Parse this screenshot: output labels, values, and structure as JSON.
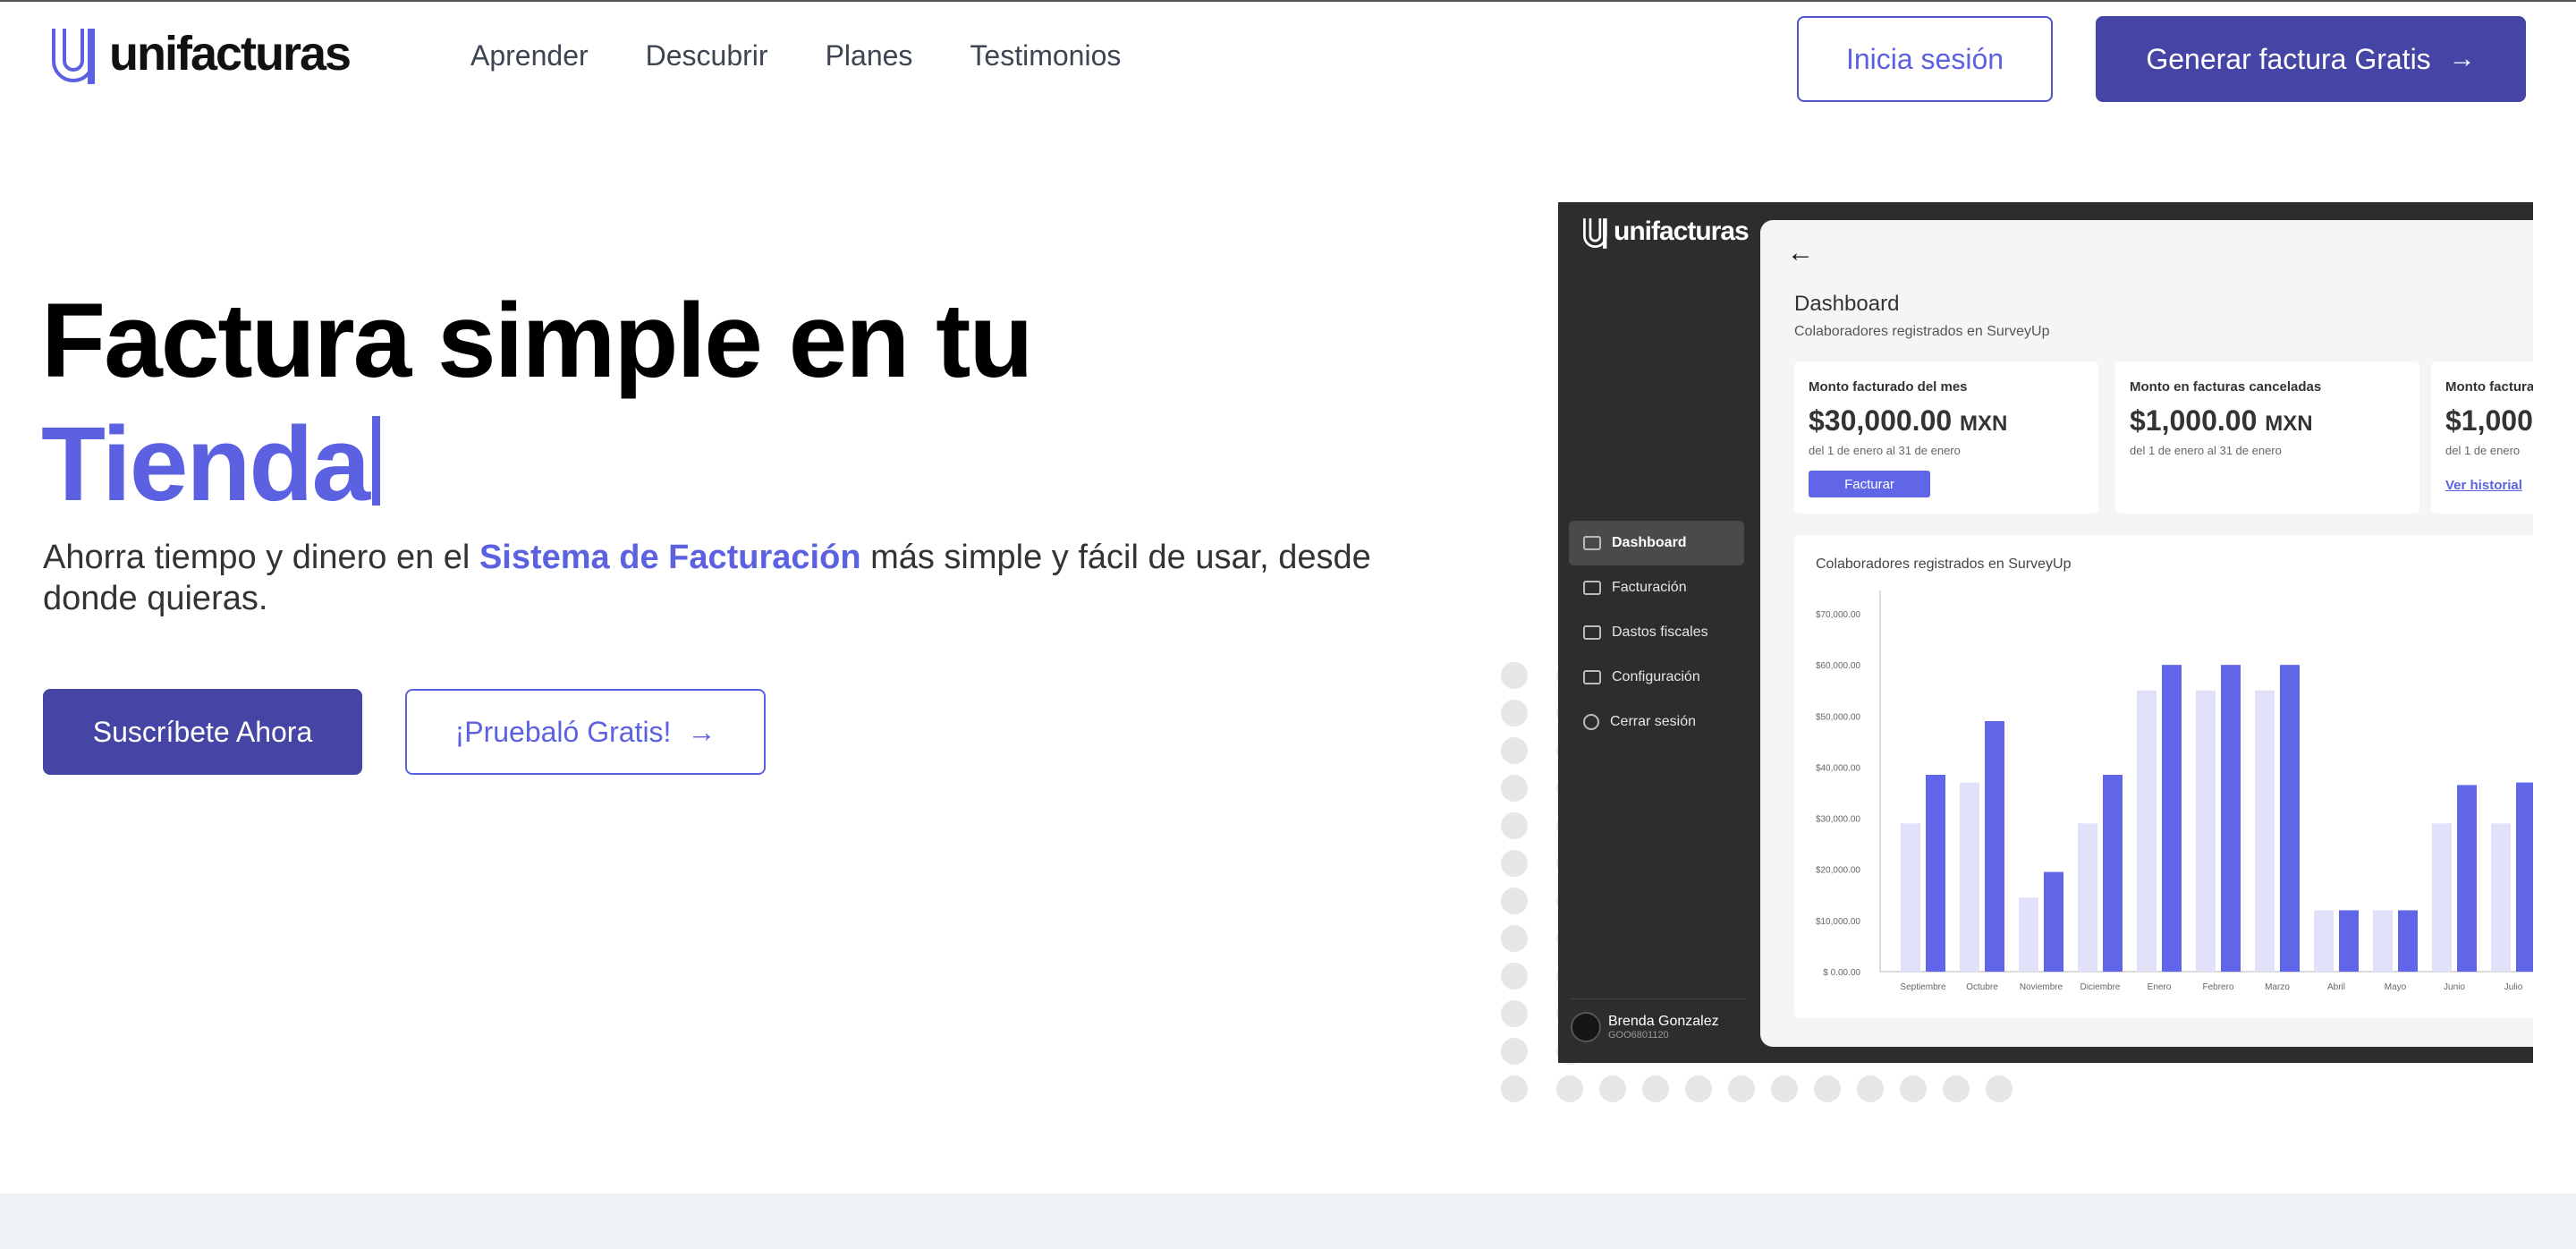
{
  "brand": {
    "name": "unifacturas",
    "accent": "#5b61e0",
    "primary": "#4545a6"
  },
  "nav": {
    "items": [
      {
        "label": "Aprender"
      },
      {
        "label": "Descubrir"
      },
      {
        "label": "Planes"
      },
      {
        "label": "Testimonios"
      }
    ],
    "login_label": "Inicia sesión",
    "cta_label": "Generar factura Gratis",
    "cta_icon": "arrow-right-icon"
  },
  "hero": {
    "title": "Factura simple en tu",
    "typed_word": "Tienda",
    "subtitle_before": "Ahorra tiempo y dinero en el ",
    "subtitle_highlight": "Sistema de Facturación",
    "subtitle_after": " más simple y fácil de usar, desde donde quieras.",
    "subscribe_label": "Suscríbete Ahora",
    "try_label": "¡Pruebaló Gratis!"
  },
  "dashboard": {
    "logo_text": "unifacturas",
    "menu": [
      {
        "label": "Dashboard",
        "icon": "monitor-icon",
        "active": true
      },
      {
        "label": "Facturación",
        "icon": "clipboard-icon",
        "active": false
      },
      {
        "label": "Dastos fiscales",
        "icon": "card-icon",
        "active": false
      },
      {
        "label": "Configuración",
        "icon": "card-icon",
        "active": false
      },
      {
        "label": "Cerrar sesión",
        "icon": "power-icon",
        "active": false
      }
    ],
    "user": {
      "name": "Brenda Gonzalez",
      "code": "GOO6801120"
    },
    "title": "Dashboard",
    "subtitle": "Colaboradores registrados en SurveyUp",
    "cards": [
      {
        "label": "Monto facturado del mes",
        "amount": "$30,000.00",
        "currency": "MXN",
        "range": "del 1 de enero al 31 de enero",
        "button": "Facturar"
      },
      {
        "label": "Monto en facturas canceladas",
        "amount": "$1,000.00",
        "currency": "MXN",
        "range": "del 1 de enero al 31 de enero"
      },
      {
        "label": "Monto facturado",
        "amount": "$1,000",
        "range": "del 1 de enero",
        "link": "Ver historial"
      }
    ],
    "chart_title": "Colaboradores registrados en SurveyUp"
  },
  "chart_data": {
    "type": "bar",
    "title": "Colaboradores registrados en SurveyUp",
    "categories": [
      "Septiembre",
      "Octubre",
      "Noviembre",
      "Diciembre",
      "Enero",
      "Febrero",
      "Marzo",
      "Abril",
      "Mayo",
      "Junio",
      "Julio"
    ],
    "y_ticks": [
      "$ 0.00.00",
      "$10,000.00",
      "$20,000.00",
      "$30,000.00",
      "$40,000.00",
      "$50,000.00",
      "$60,000.00",
      "$70,000.00"
    ],
    "ylim": [
      0,
      70000
    ],
    "series": [
      {
        "values": [
          29000,
          37000,
          14500,
          29000,
          55000,
          55000,
          55000,
          12000,
          12000,
          29000,
          29000
        ],
        "color": "#e1e2fa"
      },
      {
        "values": [
          38500,
          49000,
          19500,
          38500,
          60000,
          60000,
          60000,
          12000,
          12000,
          36500,
          37000
        ],
        "color": "#6166e8"
      }
    ],
    "grid": false
  }
}
